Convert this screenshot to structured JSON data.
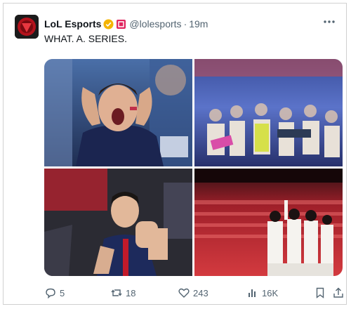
{
  "post": {
    "author_name": "LoL Esports",
    "handle": "@lolesports",
    "separator": "·",
    "time": "19m",
    "text": "WHAT. A. SERIES."
  },
  "actions": {
    "replies": "5",
    "reposts": "18",
    "likes": "243",
    "views": "16K"
  },
  "colors": {
    "verified_badge": "#f4b400",
    "affiliate_badge": "#e0245e",
    "secondary_text": "#536471"
  },
  "icons": [
    "more-icon",
    "verified-icon",
    "affiliate-icon",
    "reply-icon",
    "repost-icon",
    "like-icon",
    "views-icon",
    "bookmark-icon",
    "share-icon"
  ]
}
